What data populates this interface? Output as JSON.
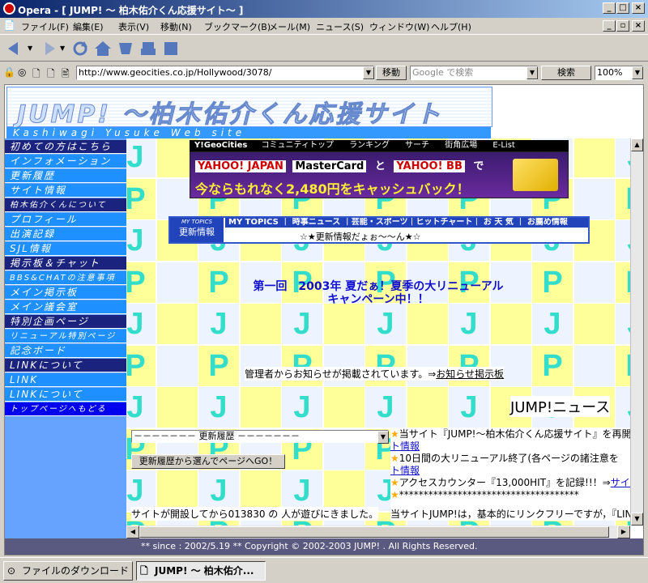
{
  "window": {
    "title": "Opera - [ JUMP! ～ 柏木佑介くん応援サイト～ ]"
  },
  "menu": [
    "ファイル(F)",
    "編集(E)",
    "表示(V)",
    "移動(N)",
    "ブックマーク(B)",
    "メール(M)",
    "ニュース(S)",
    "ウィンドウ(W)",
    "ヘルプ(H)"
  ],
  "address": {
    "url": "http://www.geocities.co.jp/Hollywood/3078/",
    "go_label": "移動",
    "search_placeholder": "Google で検索",
    "search_label": "検索",
    "zoom": "100%"
  },
  "banner": {
    "title": "JUMP! ～柏木佑介くん応援サイト",
    "subtitle": "Kashiwagi Yusuke Web site"
  },
  "nav": [
    "初めての方はこちら",
    "インフォメーション",
    "更新履歴",
    "サイト情報",
    "柏木佑介くんについて",
    "プロフィール",
    "出演記録",
    "SJL情報",
    "掲示板＆チャット",
    "BBS&CHATの注意事項",
    "メイン掲示板",
    "メイン議会室",
    "特別企画ページ",
    "リニューアル特別ページ",
    "記念ボード",
    "LINKについて",
    "LINK",
    "LINKについて",
    "トップページへもどる"
  ],
  "geocities": {
    "brand": "Y!GeoCities",
    "links": [
      "コミュニティトップ",
      "ランキング",
      "サーチ",
      "街角広場",
      "E-List"
    ]
  },
  "ad": {
    "line1_a": "YAHOO! JAPAN",
    "line1_b": "MasterCard",
    "line1_c": "と",
    "line1_d": "YAHOO! BB",
    "line1_e": "で",
    "line2": "今ならもれなく2,480円をキャッシュバック！"
  },
  "topics": {
    "label_top": "MY TOPICS",
    "label": "更新情報",
    "tabs": "MY TOPICS ｜ 時事ニュース ｜芸能・スポーツ｜ヒットチャート｜ お 天 気 ｜ お薦め情報",
    "news": "☆★更新情報だょぉ〜〜ん★☆"
  },
  "campaign": {
    "line1": "第一回　2003年 夏だぁ！夏季の大リニューアル",
    "line2": "キャンペーン中！！"
  },
  "admin_note": {
    "text": "管理者からお知らせが掲載されています。⇒",
    "link": "お知らせ掲示板"
  },
  "news": {
    "heading": "JUMP!ニュース",
    "items": [
      {
        "text": "当サイト『JUMP!～柏木佑介くん応援サイト』を再開設",
        "link": "ト情報"
      },
      {
        "text": "10日間の大リニューアル終了(各ページの諸注意を",
        "link": "ト情報"
      },
      {
        "text": "アクセスカウンター『13,000HIT』を記録!!！⇒",
        "link": "サイト情"
      },
      {
        "text": "*************************************",
        "link": ""
      }
    ],
    "policy": "当サイトJUMP!は，基本的にリンクフリーですが，『LINK"
  },
  "history": {
    "select": "－－－－－－－ 更新履歴 －－－－－－－",
    "go": "更新履歴から選んでページへGO！"
  },
  "visitors": {
    "pre": "サイトが開設してから",
    "count": "013830",
    "post": " の 人が遊びにきました。"
  },
  "footer": "** since : 2002/5.19 **   Copyright  ©  2002-2003  JUMP! . All Rights Reserved.",
  "taskbar": [
    "ファイルのダウンロード",
    "JUMP! ～ 柏木佑介..."
  ],
  "colors": {
    "accent_navy": "#1a237e",
    "nav_blue": "#1e90ff",
    "check_yellow": "#ffff99",
    "letter_cyan": "#33ddcc",
    "campaign_blue": "#1010cc"
  }
}
